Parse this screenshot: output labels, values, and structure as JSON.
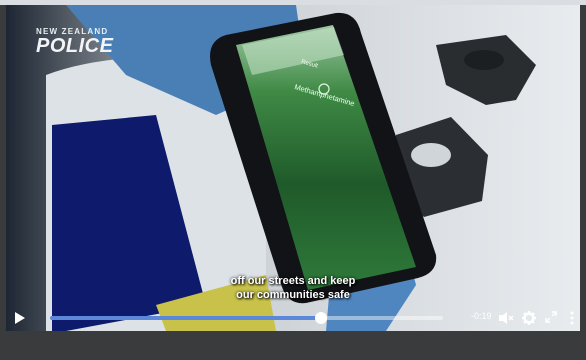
{
  "video": {
    "logo_top": "NEW ZEALAND",
    "logo_main": "POLICE",
    "phone_result_label": "Result",
    "phone_result_value": "Methamphetamine",
    "subtitle_line1": "off our streets and keep",
    "subtitle_line2": "our communities safe"
  },
  "player": {
    "time_remaining": "-0:19",
    "progress": 0.69,
    "accent_color": "#5b88d9",
    "icons": [
      "play-icon",
      "volume-muted-icon",
      "settings-gear-icon",
      "fullscreen-icon",
      "more-options-icon"
    ]
  }
}
